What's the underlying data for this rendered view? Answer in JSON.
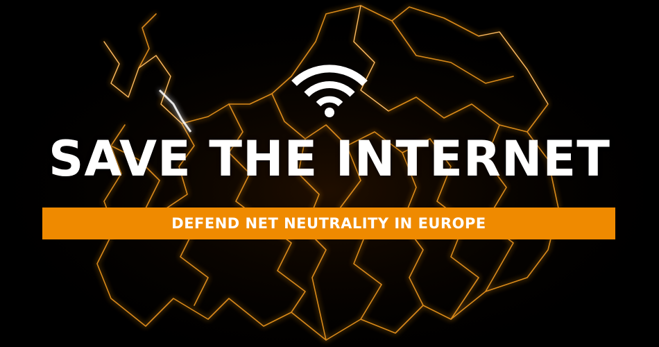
{
  "headline": "SAVE THE INTERNET",
  "banner": {
    "text": "DEFEND NET NEUTRALITY IN EUROPE",
    "color": "#ef8a00"
  },
  "icons": {
    "wifi": "wifi-icon"
  },
  "colors": {
    "background": "#000000",
    "lightning": "#f39a1e",
    "headline": "#ffffff"
  }
}
